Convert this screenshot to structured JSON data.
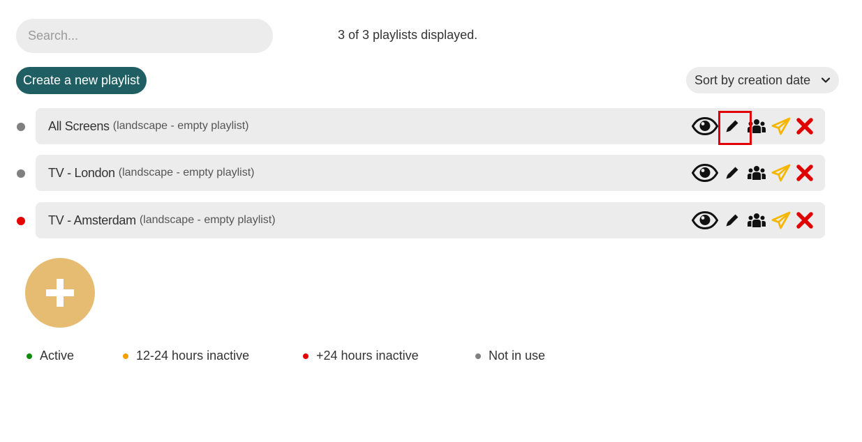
{
  "search": {
    "placeholder": "Search..."
  },
  "count_text": "3 of 3 playlists displayed.",
  "create_button": "Create a new playlist",
  "sort": {
    "selected": "Sort by creation date"
  },
  "playlists": [
    {
      "name": "All Screens",
      "details": "(landscape - empty playlist)",
      "status": "Not in use",
      "status_color": "#808080"
    },
    {
      "name": "TV -  London",
      "details": "(landscape - empty playlist)",
      "status": "Not in use",
      "status_color": "#808080"
    },
    {
      "name": "TV - Amsterdam",
      "details": "(landscape - empty playlist)",
      "status": "+24 hours inactive",
      "status_color": "#e60000"
    }
  ],
  "row_action_icons": [
    "eye-icon",
    "pencil-icon",
    "people-icon",
    "send-icon",
    "close-icon"
  ],
  "add_button_icon": "plus-icon",
  "legend": [
    {
      "label": "Active",
      "color": "#0b8a0b"
    },
    {
      "label": "12-24 hours inactive",
      "color": "#f5a000"
    },
    {
      "label": "+24 hours inactive",
      "color": "#e60000"
    },
    {
      "label": "Not in use",
      "color": "#808080"
    }
  ],
  "colors": {
    "primary": "#1f5f63",
    "add_button": "#e6bc72",
    "send_icon": "#f5b700",
    "delete_icon": "#e00000",
    "highlight": "#e00000"
  }
}
